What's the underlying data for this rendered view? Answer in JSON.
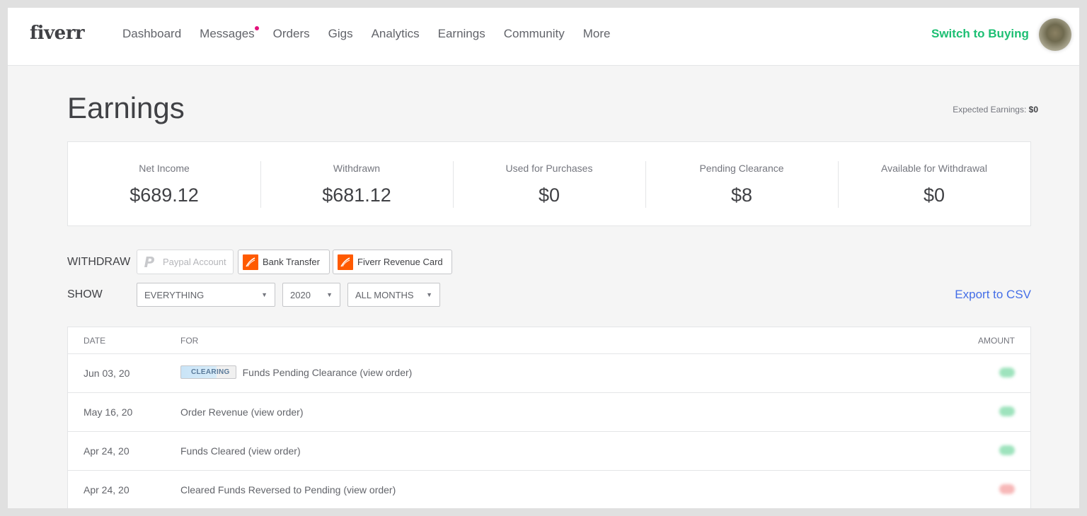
{
  "header": {
    "logo": "fiverr",
    "nav": [
      "Dashboard",
      "Messages",
      "Orders",
      "Gigs",
      "Analytics",
      "Earnings",
      "Community",
      "More"
    ],
    "switch_label": "Switch to Buying"
  },
  "page": {
    "title": "Earnings",
    "expected_label": "Expected Earnings:",
    "expected_value": "$0"
  },
  "stats": [
    {
      "label": "Net Income",
      "value": "$689.12"
    },
    {
      "label": "Withdrawn",
      "value": "$681.12"
    },
    {
      "label": "Used for Purchases",
      "value": "$0"
    },
    {
      "label": "Pending Clearance",
      "value": "$8"
    },
    {
      "label": "Available for Withdrawal",
      "value": "$0"
    }
  ],
  "withdraw": {
    "label": "WITHDRAW",
    "paypal": "Paypal Account",
    "bank": "Bank Transfer",
    "card": "Fiverr Revenue Card"
  },
  "filters": {
    "label": "SHOW",
    "type": "EVERYTHING",
    "year": "2020",
    "month": "ALL MONTHS",
    "export": "Export to CSV"
  },
  "table": {
    "headers": {
      "date": "DATE",
      "for": "FOR",
      "amount": "AMOUNT"
    },
    "rows": [
      {
        "date": "Jun 03, 20",
        "badge": "CLEARING",
        "for": "Funds Pending Clearance (view order)",
        "amount_status": "positive"
      },
      {
        "date": "May 16, 20",
        "for": "Order Revenue (view order)",
        "amount_status": "positive"
      },
      {
        "date": "Apr 24, 20",
        "for": "Funds Cleared (view order)",
        "amount_status": "positive"
      },
      {
        "date": "Apr 24, 20",
        "for": "Cleared Funds Reversed to Pending (view order)",
        "amount_status": "negative"
      }
    ]
  },
  "colors": {
    "brand_green": "#1dbf73",
    "link_blue": "#446ee7",
    "card_orange": "#ff5a00",
    "notification_dot": "#e3117c"
  }
}
